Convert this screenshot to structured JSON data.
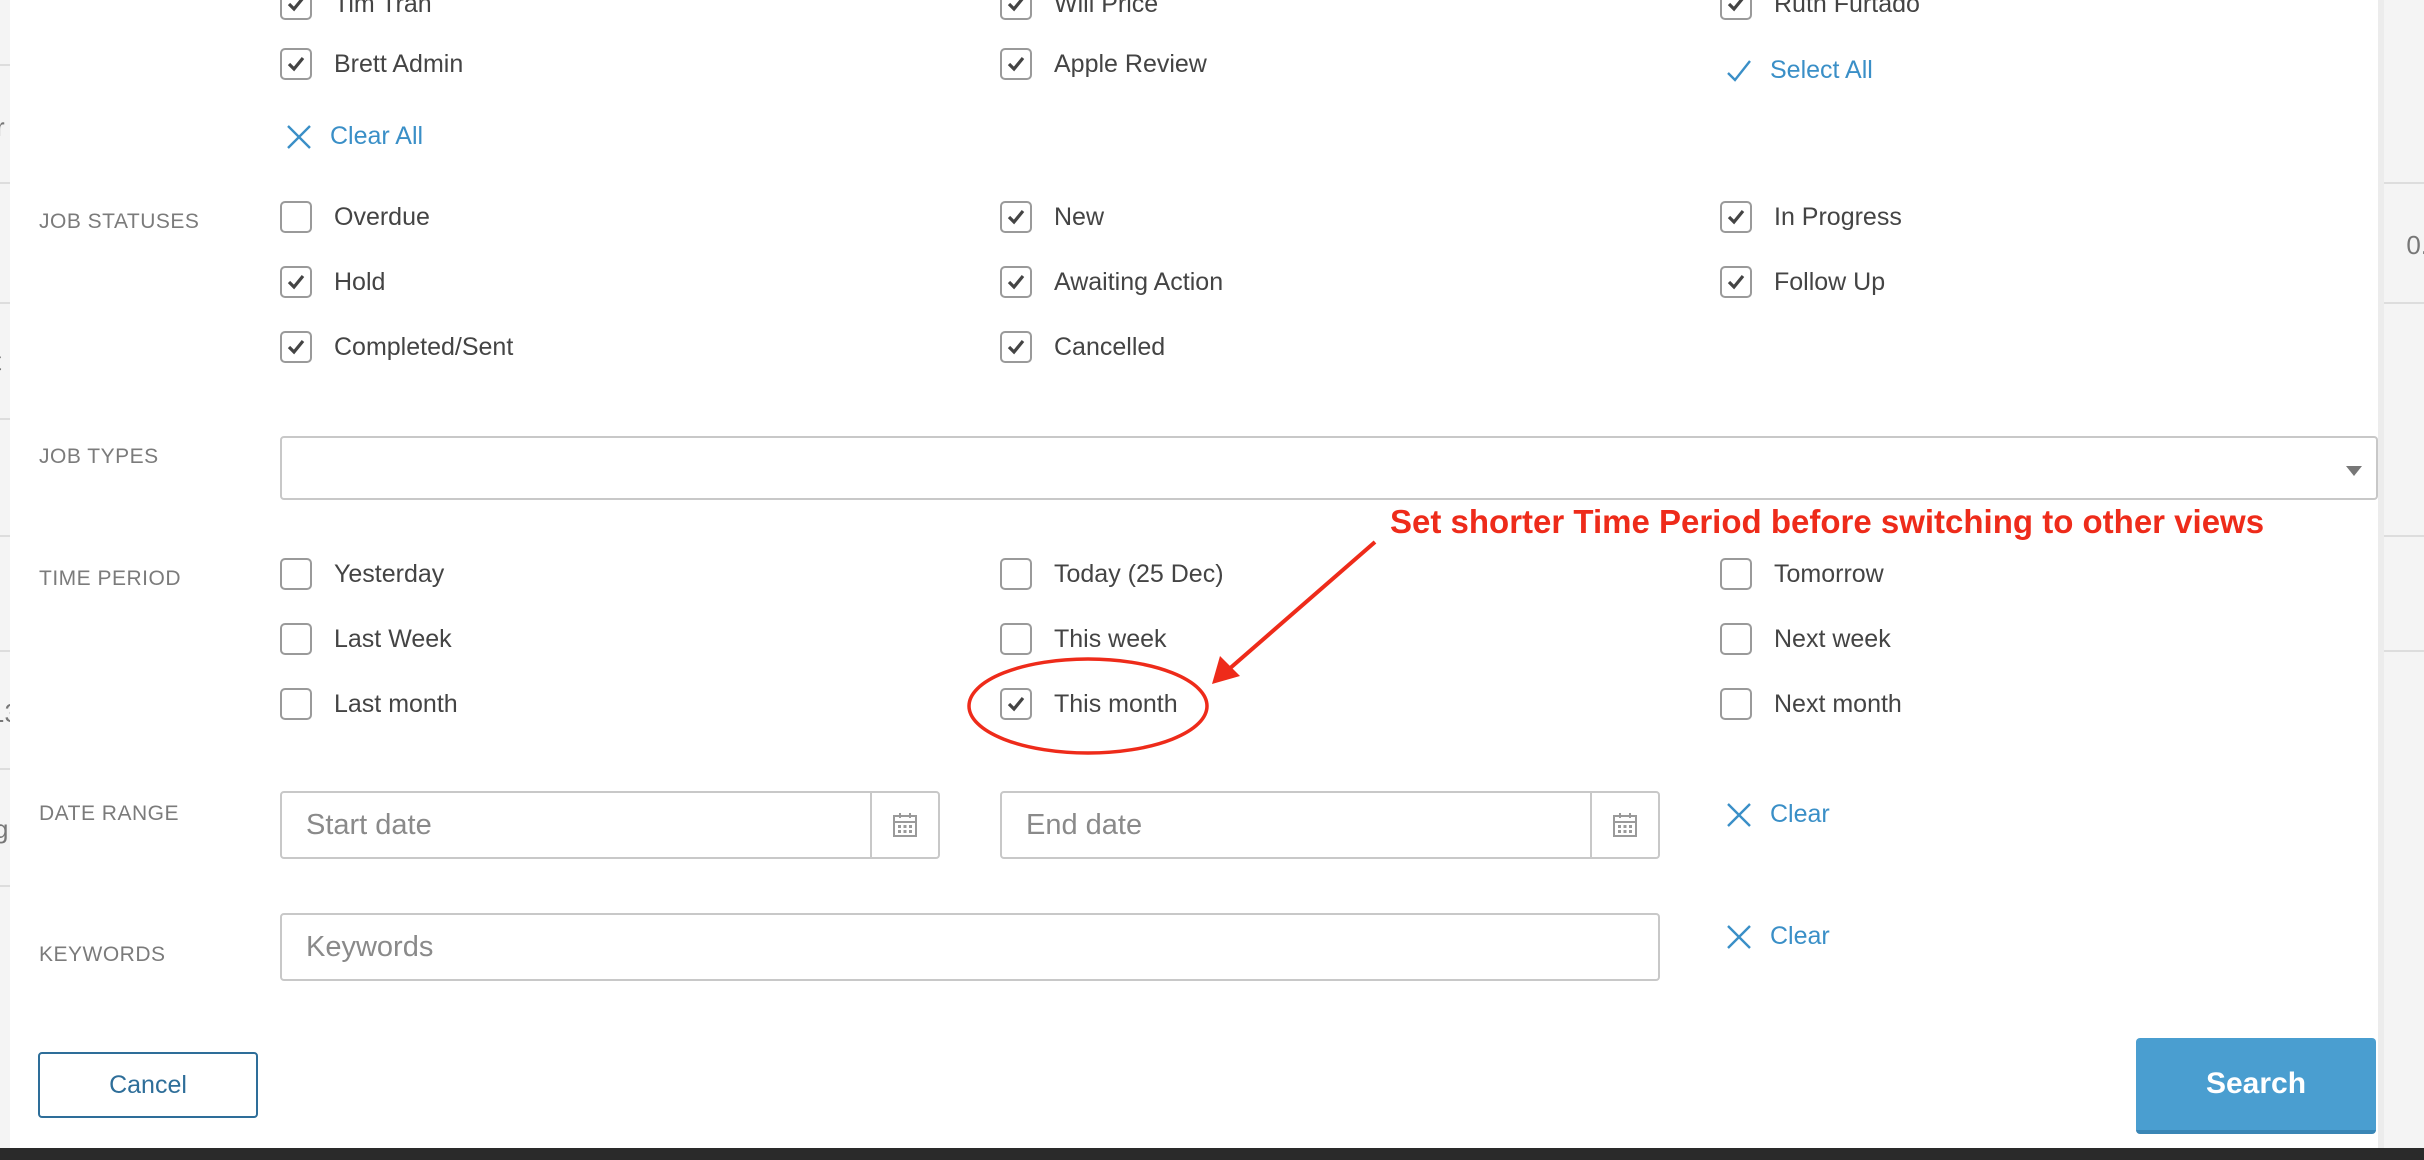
{
  "background": {
    "left_fragments": [
      "r",
      "t",
      "13",
      "g"
    ],
    "right_fragments": [
      "0."
    ]
  },
  "assignees": {
    "rows": [
      [
        {
          "label": "Tim Tran",
          "checked": true
        },
        {
          "label": "Will Price",
          "checked": true
        },
        {
          "label": "Ruth Furtado",
          "checked": true
        }
      ],
      [
        {
          "label": "Brett Admin",
          "checked": true
        },
        {
          "label": "Apple Review",
          "checked": true
        }
      ]
    ],
    "select_all_label": "Select All",
    "clear_all_label": "Clear All"
  },
  "job_statuses": {
    "label": "JOB STATUSES",
    "items": [
      {
        "label": "Overdue",
        "checked": false
      },
      {
        "label": "New",
        "checked": true
      },
      {
        "label": "In Progress",
        "checked": true
      },
      {
        "label": "Hold",
        "checked": true
      },
      {
        "label": "Awaiting Action",
        "checked": true
      },
      {
        "label": "Follow Up",
        "checked": true
      },
      {
        "label": "Completed/Sent",
        "checked": true
      },
      {
        "label": "Cancelled",
        "checked": true
      }
    ]
  },
  "job_types": {
    "label": "JOB TYPES",
    "value": ""
  },
  "time_period": {
    "label": "TIME PERIOD",
    "items": [
      {
        "label": "Yesterday",
        "checked": false
      },
      {
        "label": "Today (25 Dec)",
        "checked": false
      },
      {
        "label": "Tomorrow",
        "checked": false
      },
      {
        "label": "Last Week",
        "checked": false
      },
      {
        "label": "This week",
        "checked": false
      },
      {
        "label": "Next week",
        "checked": false
      },
      {
        "label": "Last month",
        "checked": false
      },
      {
        "label": "This month",
        "checked": true
      },
      {
        "label": "Next month",
        "checked": false
      }
    ]
  },
  "date_range": {
    "label": "DATE RANGE",
    "start_placeholder": "Start date",
    "end_placeholder": "End date",
    "clear_label": "Clear"
  },
  "keywords": {
    "label": "KEYWORDS",
    "placeholder": "Keywords",
    "clear_label": "Clear"
  },
  "actions": {
    "cancel_label": "Cancel",
    "search_label": "Search"
  },
  "annotation": {
    "text": "Set shorter Time Period before switching to other views",
    "color": "#ee2b1a"
  },
  "colors": {
    "link": "#3a8fc7",
    "primary_button": "#4a9ed0",
    "cancel_border": "#2e6e99"
  }
}
